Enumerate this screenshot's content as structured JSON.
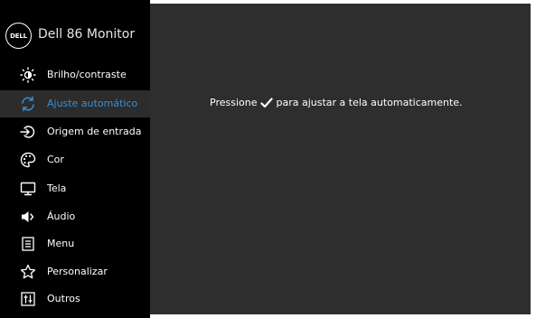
{
  "monitor": {
    "brand_logo_text": "DELL",
    "title": "Dell 86 Monitor"
  },
  "menu": {
    "items": [
      {
        "label": "Brilho/contraste",
        "icon": "brightness-icon",
        "active": false
      },
      {
        "label": "Ajuste automático",
        "icon": "auto-adjust-icon",
        "active": true
      },
      {
        "label": "Origem de entrada",
        "icon": "input-source-icon",
        "active": false
      },
      {
        "label": "Cor",
        "icon": "color-palette-icon",
        "active": false
      },
      {
        "label": "Tela",
        "icon": "display-icon",
        "active": false
      },
      {
        "label": "Áudio",
        "icon": "speaker-icon",
        "active": false
      },
      {
        "label": "Menu",
        "icon": "menu-list-icon",
        "active": false
      },
      {
        "label": "Personalizar",
        "icon": "star-icon",
        "active": false
      },
      {
        "label": "Outros",
        "icon": "others-icon",
        "active": false
      }
    ]
  },
  "content": {
    "instruction_before": "Pressione",
    "instruction_icon": "checkmark-icon",
    "instruction_after": "para ajustar a tela automaticamente."
  },
  "colors": {
    "sidebar_bg": "#000000",
    "content_bg": "#2e2e2e",
    "active_item_bg": "#2c2c2c",
    "active_text": "#3a8fd4",
    "text": "#ffffff"
  }
}
